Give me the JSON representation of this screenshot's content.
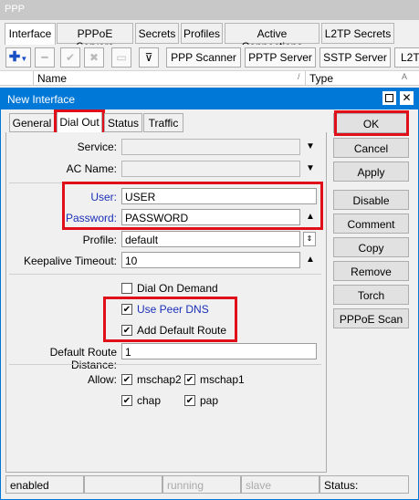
{
  "app": {
    "title": "PPP"
  },
  "tabs": [
    "Interface",
    "PPPoE Servers",
    "Secrets",
    "Profiles",
    "Active Connections",
    "L2TP Secrets"
  ],
  "toolbar": {
    "add_icon": "plus-icon",
    "remove_icon": "minus-icon",
    "enable_icon": "check-icon",
    "disable_icon": "x-icon",
    "comment_icon": "comment-icon",
    "filter_icon": "filter-icon",
    "ppp_scanner": "PPP Scanner",
    "pptp_server": "PPTP Server",
    "sstp_server": "SSTP Server",
    "l2tp": "L2T"
  },
  "columns": {
    "name": "Name",
    "type": "Type",
    "sort_mark_a": "/",
    "sort_mark_b": "A"
  },
  "dialog": {
    "title": "New Interface",
    "tabs": [
      "General",
      "Dial Out",
      "Status",
      "Traffic"
    ],
    "fields": {
      "service_label": "Service:",
      "service_value": "",
      "ac_name_label": "AC Name:",
      "ac_name_value": "",
      "user_label": "User:",
      "user_value": "USER",
      "password_label": "Password:",
      "password_value": "PASSWORD",
      "profile_label": "Profile:",
      "profile_value": "default",
      "keepalive_label": "Keepalive Timeout:",
      "keepalive_value": "10",
      "route_distance_label": "Default Route Distance:",
      "route_distance_value": "1",
      "allow_label": "Allow:"
    },
    "checkboxes": {
      "dial_on_demand": {
        "label": "Dial On Demand",
        "checked": false
      },
      "use_peer_dns": {
        "label": "Use Peer DNS",
        "checked": true
      },
      "add_default_route": {
        "label": "Add Default Route",
        "checked": true
      },
      "mschap2": {
        "label": "mschap2",
        "checked": true
      },
      "mschap1": {
        "label": "mschap1",
        "checked": true
      },
      "chap": {
        "label": "chap",
        "checked": true
      },
      "pap": {
        "label": "pap",
        "checked": true
      }
    },
    "buttons": [
      "OK",
      "Cancel",
      "Apply",
      "Disable",
      "Comment",
      "Copy",
      "Remove",
      "Torch",
      "PPPoE Scan"
    ],
    "status": [
      "enabled",
      "",
      "running",
      "slave",
      "Status:"
    ]
  },
  "colors": {
    "accent": "#0078d7",
    "highlight": "#e0101a",
    "label_blue": "#1a2fb8"
  }
}
